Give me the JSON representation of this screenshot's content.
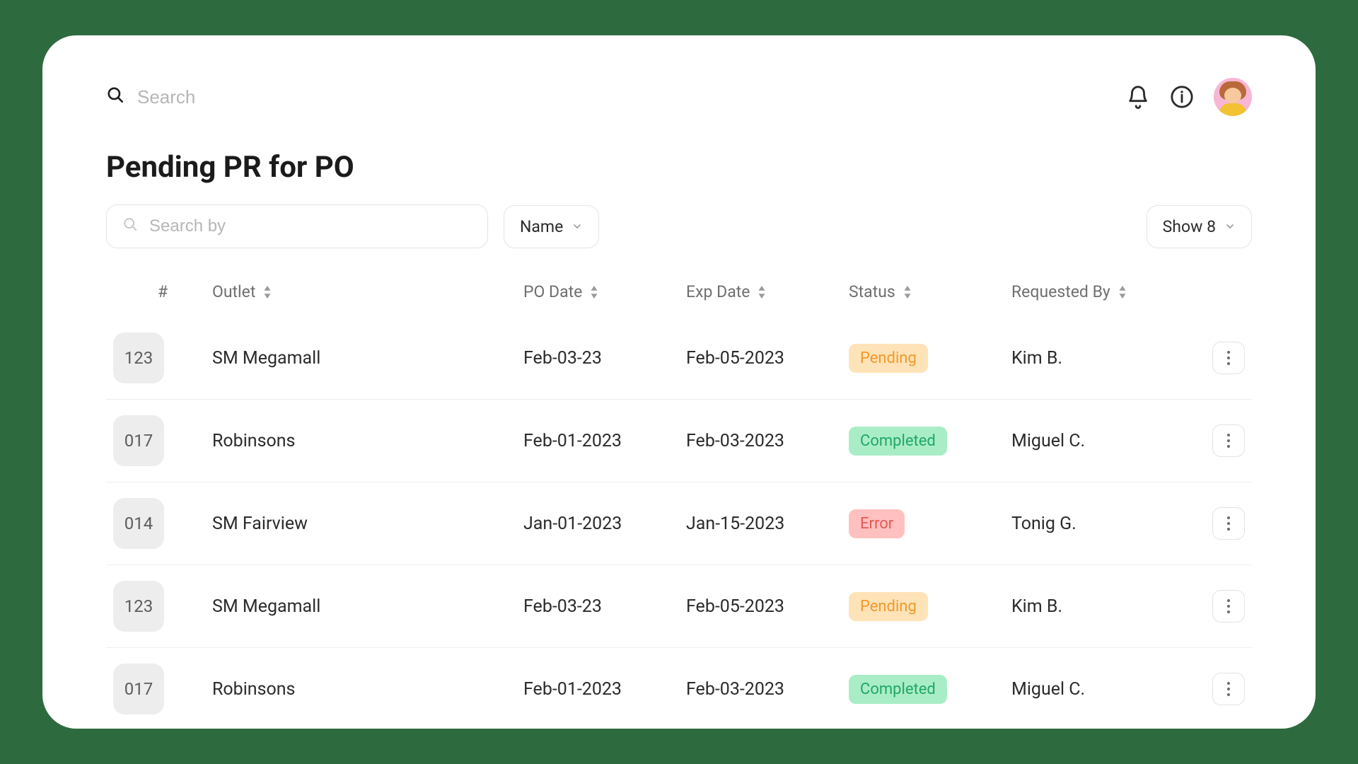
{
  "topbar": {
    "search_placeholder": "Search"
  },
  "page_title": "Pending PR for  PO",
  "filters": {
    "searchby_placeholder": "Search by",
    "sort_select_label": "Name",
    "show_select_label": "Show 8"
  },
  "columns": {
    "num": "#",
    "outlet": "Outlet",
    "po_date": "PO Date",
    "exp_date": "Exp Date",
    "status": "Status",
    "requested_by": "Requested By"
  },
  "status_labels": {
    "pending": "Pending",
    "completed": "Completed",
    "error": "Error"
  },
  "rows": [
    {
      "num": "123",
      "outlet": "SM Megamall",
      "po_date": "Feb-03-23",
      "exp_date": "Feb-05-2023",
      "status": "pending",
      "requested_by": "Kim B."
    },
    {
      "num": "017",
      "outlet": "Robinsons",
      "po_date": "Feb-01-2023",
      "exp_date": "Feb-03-2023",
      "status": "completed",
      "requested_by": "Miguel C."
    },
    {
      "num": "014",
      "outlet": "SM Fairview",
      "po_date": "Jan-01-2023",
      "exp_date": "Jan-15-2023",
      "status": "error",
      "requested_by": "Tonig G."
    },
    {
      "num": "123",
      "outlet": "SM Megamall",
      "po_date": "Feb-03-23",
      "exp_date": "Feb-05-2023",
      "status": "pending",
      "requested_by": "Kim B."
    },
    {
      "num": "017",
      "outlet": "Robinsons",
      "po_date": "Feb-01-2023",
      "exp_date": "Feb-03-2023",
      "status": "completed",
      "requested_by": "Miguel C."
    }
  ]
}
